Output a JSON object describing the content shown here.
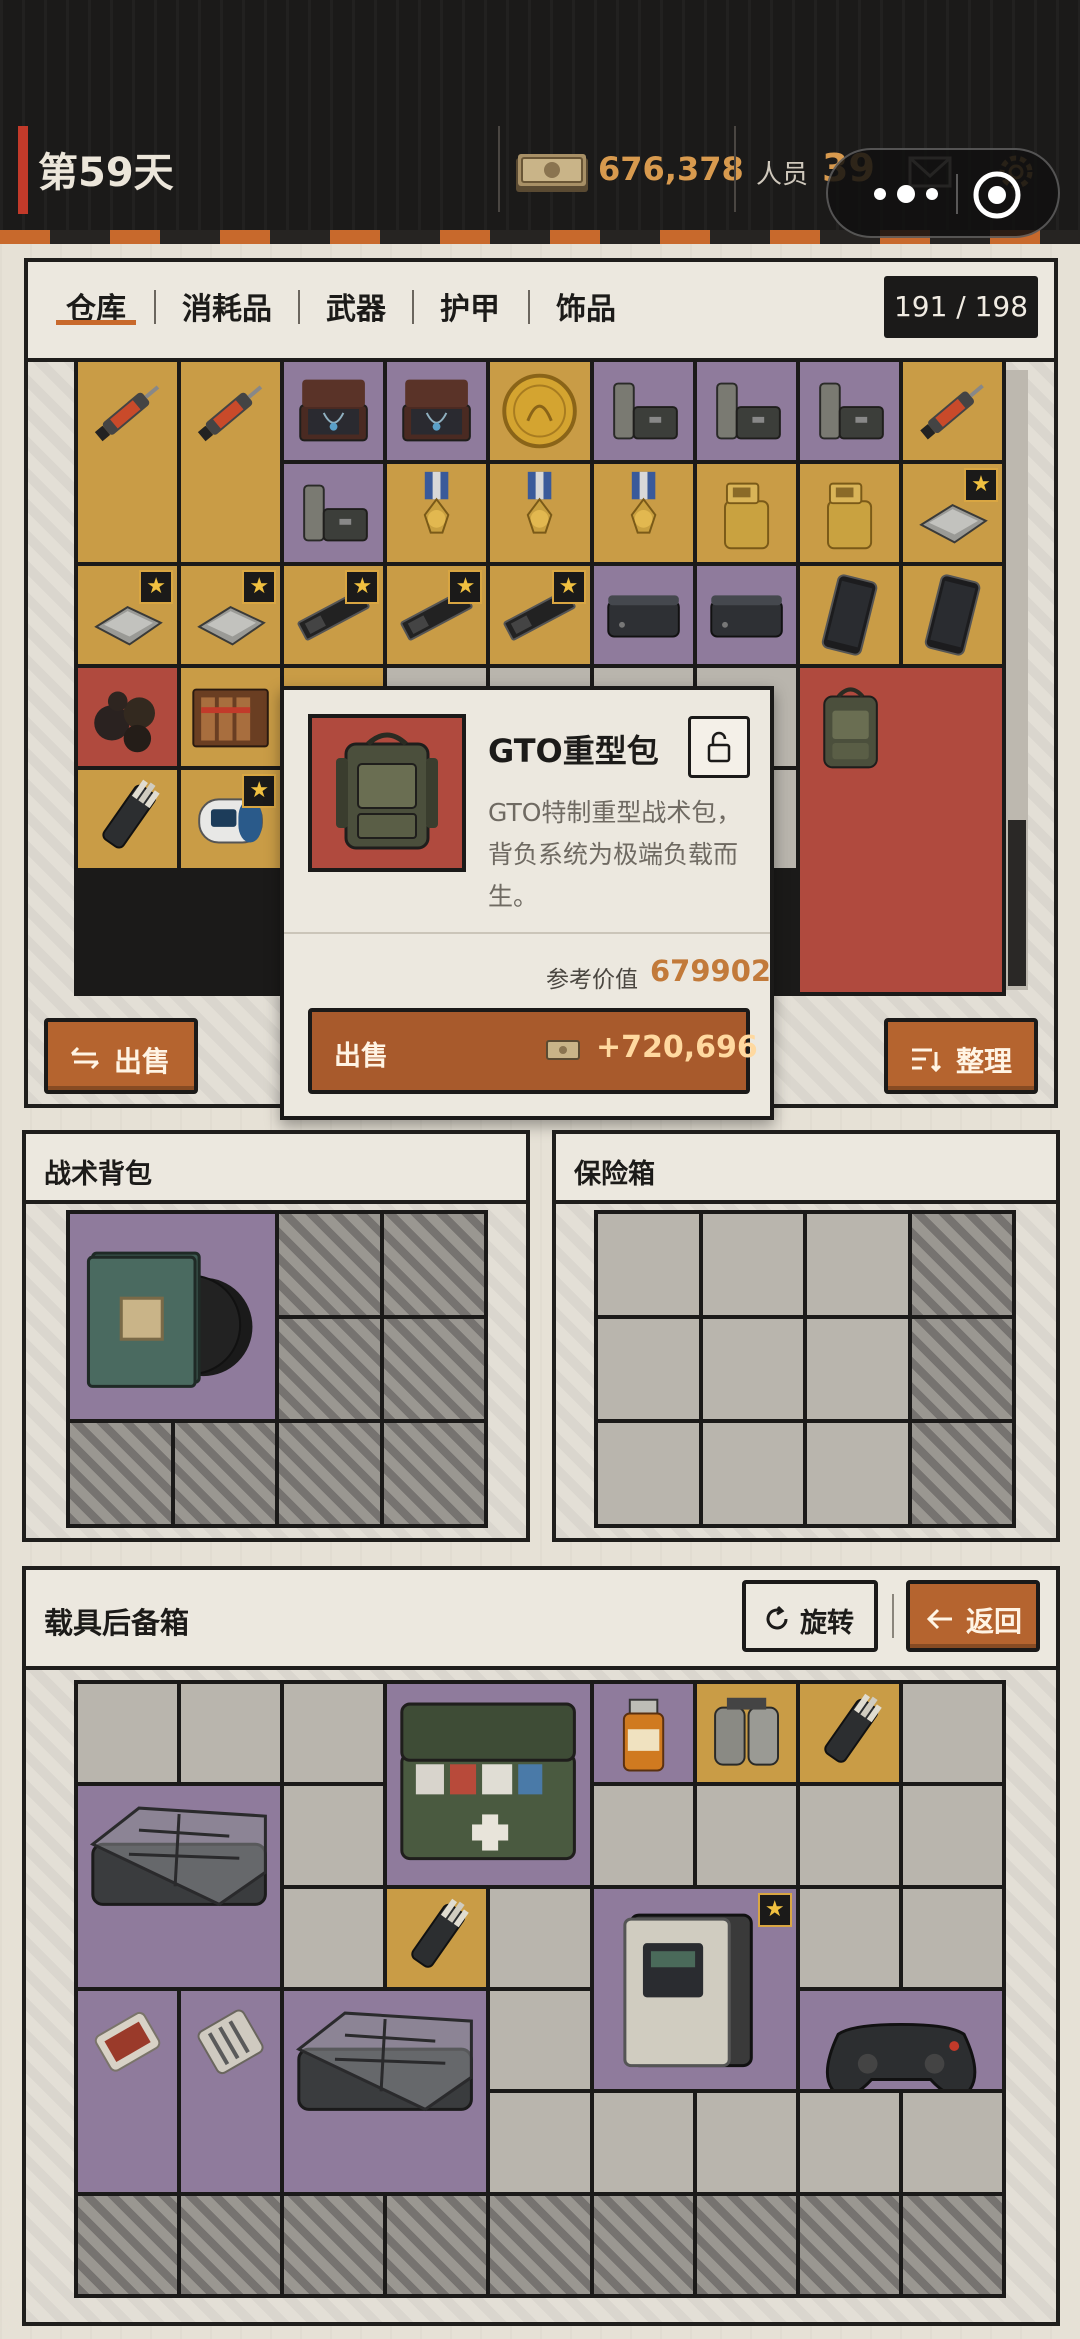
{
  "topbar": {
    "day": "第59天",
    "cash": "676,378",
    "staff_label": "人员",
    "staff_count": "39"
  },
  "warehouse": {
    "tabs": [
      {
        "label": "仓库",
        "active": true
      },
      {
        "label": "消耗品",
        "active": false
      },
      {
        "label": "武器",
        "active": false
      },
      {
        "label": "护甲",
        "active": false
      },
      {
        "label": "饰品",
        "active": false
      }
    ],
    "capacity": "191 / 198",
    "sell_label": "出售",
    "sort_label": "整理",
    "items": [
      {
        "name": "syringe-stim-icon",
        "star": false
      },
      {
        "name": "syringe-stim-icon",
        "star": false
      },
      {
        "name": "jewelry-case-icon",
        "star": false
      },
      {
        "name": "jewelry-case-icon",
        "star": false
      },
      {
        "name": "gold-coin-icon",
        "star": false
      },
      {
        "name": "gas-canister-case-icon",
        "star": false
      },
      {
        "name": "gas-canister-case-icon",
        "star": false
      },
      {
        "name": "gas-canister-case-icon",
        "star": false
      },
      {
        "name": "syringe-stim-icon",
        "star": false
      },
      {
        "name": "gas-canister-case-icon",
        "star": false
      },
      {
        "name": "medal-icon",
        "star": false
      },
      {
        "name": "medal-icon",
        "star": false
      },
      {
        "name": "medal-icon",
        "star": false
      },
      {
        "name": "gold-lighter-icon",
        "star": false
      },
      {
        "name": "gold-lighter-icon",
        "star": false
      },
      {
        "name": "cpu-chip-icon",
        "star": true
      },
      {
        "name": "cpu-chip-icon",
        "star": true
      },
      {
        "name": "cpu-chip-icon",
        "star": true
      },
      {
        "name": "ssd-card-icon",
        "star": true
      },
      {
        "name": "ssd-card-icon",
        "star": true
      },
      {
        "name": "ssd-card-icon",
        "star": true
      },
      {
        "name": "mini-pc-icon",
        "star": false
      },
      {
        "name": "mini-pc-icon",
        "star": false
      },
      {
        "name": "smartphone-icon",
        "star": false
      },
      {
        "name": "smartphone-icon",
        "star": false
      },
      {
        "name": "truffle-icon",
        "star": false
      },
      {
        "name": "cigar-box-icon",
        "star": false
      },
      {
        "name": "heavy-backpack-icon",
        "star": false
      },
      {
        "name": "flashlight-bundle-icon",
        "star": false
      },
      {
        "name": "pulse-oximeter-icon",
        "star": true
      }
    ]
  },
  "tooltip": {
    "name": "GTO重型包",
    "description": "GTO特制重型战术包，背负系统为极端负载而生。",
    "ref_label": "参考价值",
    "ref_value": "679902",
    "sell_label": "出售",
    "sell_value": "+720,696"
  },
  "backpack": {
    "title": "战术背包",
    "items": [
      {
        "name": "vinyl-records-icon"
      }
    ]
  },
  "safe": {
    "title": "保险箱"
  },
  "trunk": {
    "title": "载具后备箱",
    "rotate_label": "旋转",
    "back_label": "返回",
    "items": [
      {
        "name": "medical-kit-icon",
        "star": false
      },
      {
        "name": "medicine-bottle-icon",
        "star": false
      },
      {
        "name": "twin-canister-icon",
        "star": false
      },
      {
        "name": "flashlight-bundle-icon",
        "star": false
      },
      {
        "name": "storage-box-icon",
        "star": false
      },
      {
        "name": "flashlight-bundle-icon",
        "star": false
      },
      {
        "name": "control-module-icon",
        "star": true
      },
      {
        "name": "gamepad-icon",
        "star": false
      },
      {
        "name": "jerky-pack-icon",
        "star": false
      },
      {
        "name": "cutlery-pack-icon",
        "star": false
      },
      {
        "name": "storage-box-icon",
        "star": false
      }
    ]
  },
  "colors": {
    "accent": "#c8692c",
    "rare_yellow": "#c99c46",
    "epic_purple": "#8f7b9c",
    "legend_red": "#b04a3e",
    "topbar": "#1b1a19"
  }
}
